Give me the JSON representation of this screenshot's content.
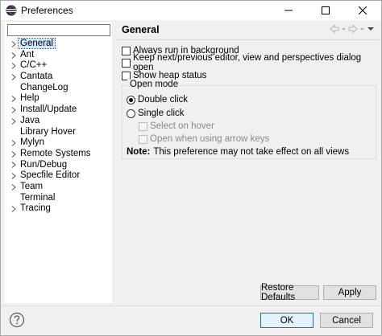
{
  "window": {
    "title": "Preferences",
    "minimize_icon": "minimize-icon",
    "maximize_icon": "maximize-icon",
    "close_icon": "close-icon"
  },
  "filter": {
    "value": "",
    "placeholder": ""
  },
  "tree": {
    "items": [
      {
        "label": "General",
        "expandable": true,
        "selected": true
      },
      {
        "label": "Ant",
        "expandable": true,
        "selected": false
      },
      {
        "label": "C/C++",
        "expandable": true,
        "selected": false
      },
      {
        "label": "Cantata",
        "expandable": true,
        "selected": false
      },
      {
        "label": "ChangeLog",
        "expandable": false,
        "selected": false
      },
      {
        "label": "Help",
        "expandable": true,
        "selected": false
      },
      {
        "label": "Install/Update",
        "expandable": true,
        "selected": false
      },
      {
        "label": "Java",
        "expandable": true,
        "selected": false
      },
      {
        "label": "Library Hover",
        "expandable": false,
        "selected": false
      },
      {
        "label": "Mylyn",
        "expandable": true,
        "selected": false
      },
      {
        "label": "Remote Systems",
        "expandable": true,
        "selected": false
      },
      {
        "label": "Run/Debug",
        "expandable": true,
        "selected": false
      },
      {
        "label": "Specfile Editor",
        "expandable": true,
        "selected": false
      },
      {
        "label": "Team",
        "expandable": true,
        "selected": false
      },
      {
        "label": "Terminal",
        "expandable": false,
        "selected": false
      },
      {
        "label": "Tracing",
        "expandable": true,
        "selected": false
      }
    ]
  },
  "page": {
    "title": "General",
    "options": {
      "always_run_bg": "Always run in background",
      "keep_next_prev": "Keep next/previous editor, view and perspectives dialog open",
      "show_heap": "Show heap status"
    },
    "open_mode": {
      "title": "Open mode",
      "double_click": "Double click",
      "single_click": "Single click",
      "select_on_hover": "Select on hover",
      "open_arrow_keys": "Open when using arrow keys",
      "note_label": "Note:",
      "note_text": "This preference may not take effect on all views"
    },
    "restore_defaults": "Restore Defaults",
    "apply": "Apply"
  },
  "footer": {
    "ok": "OK",
    "cancel": "Cancel",
    "help_icon": "help-icon"
  },
  "colors": {
    "selection": "#cce8ff",
    "default_button_border": "#0078d7"
  }
}
